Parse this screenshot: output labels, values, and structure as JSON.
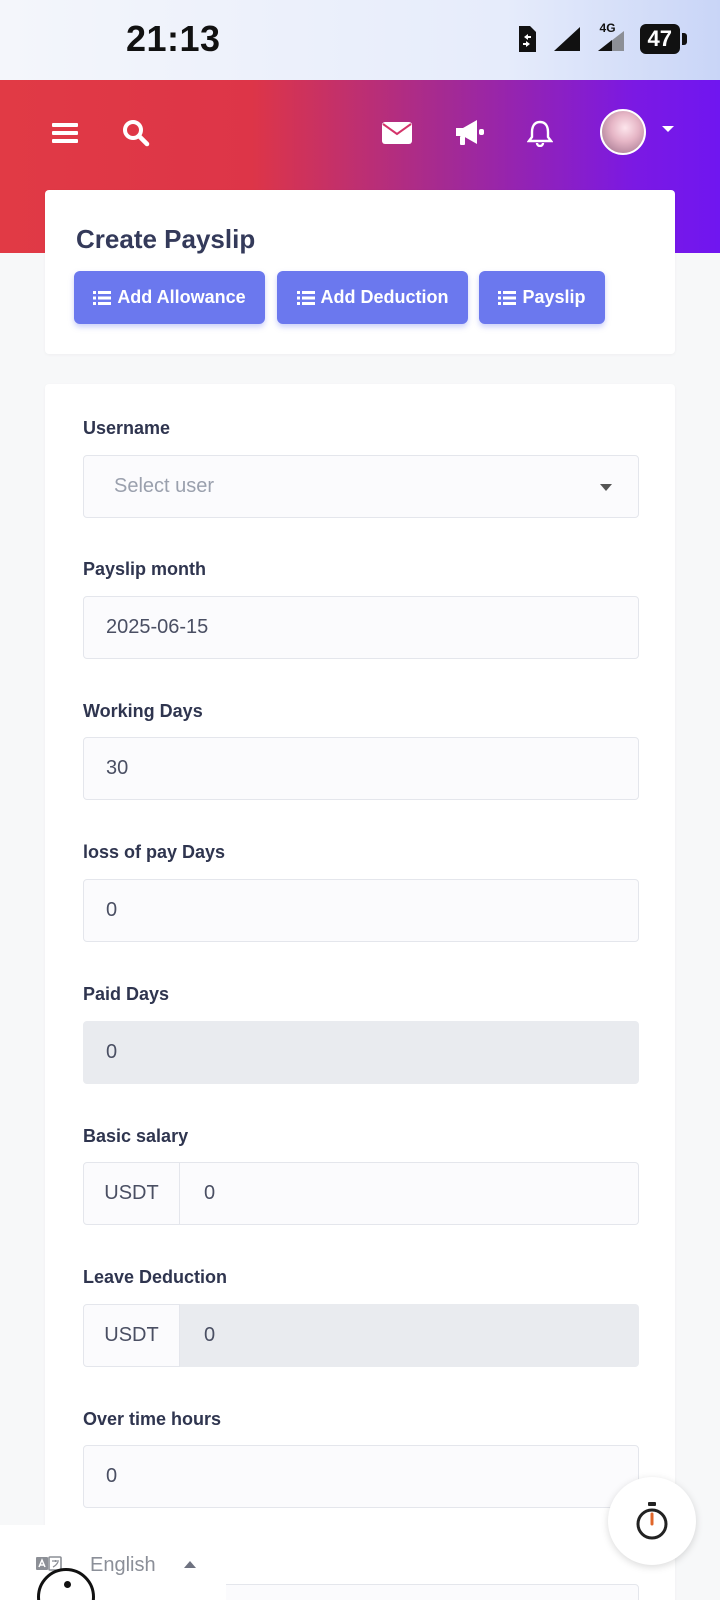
{
  "status_bar": {
    "time": "21:13",
    "network_label": "4G",
    "battery": "47"
  },
  "nav": {
    "menu_icon": "bars-icon",
    "search_icon": "search-icon",
    "mail_icon": "envelope-icon",
    "announce_icon": "megaphone-icon",
    "bell_icon": "bell-icon"
  },
  "header_card": {
    "title": "Create Payslip",
    "buttons": [
      {
        "label": "Add Allowance",
        "icon": "list-icon"
      },
      {
        "label": "Add Deduction",
        "icon": "list-icon"
      },
      {
        "label": "Payslip",
        "icon": "list-icon"
      }
    ]
  },
  "form": {
    "username": {
      "label": "Username",
      "placeholder": "Select user"
    },
    "payslip_month": {
      "label": "Payslip month",
      "value": "2025-06-15"
    },
    "working_days": {
      "label": "Working Days",
      "value": "30"
    },
    "loss_of_pay_days": {
      "label": "loss of pay Days",
      "value": "0"
    },
    "paid_days": {
      "label": "Paid Days",
      "value": "0"
    },
    "basic_salary": {
      "label": "Basic salary",
      "currency": "USDT",
      "value": "0"
    },
    "leave_deduction": {
      "label": "Leave Deduction",
      "currency": "USDT",
      "value": "0"
    },
    "over_time_hours": {
      "label": "Over time hours",
      "value": "0"
    }
  },
  "language": {
    "current": "English"
  },
  "colors": {
    "header_gradient_start": "#e13a45",
    "header_gradient_end": "#7016f0",
    "button_primary": "#6b78ee",
    "disabled_field": "#e9ebef"
  }
}
